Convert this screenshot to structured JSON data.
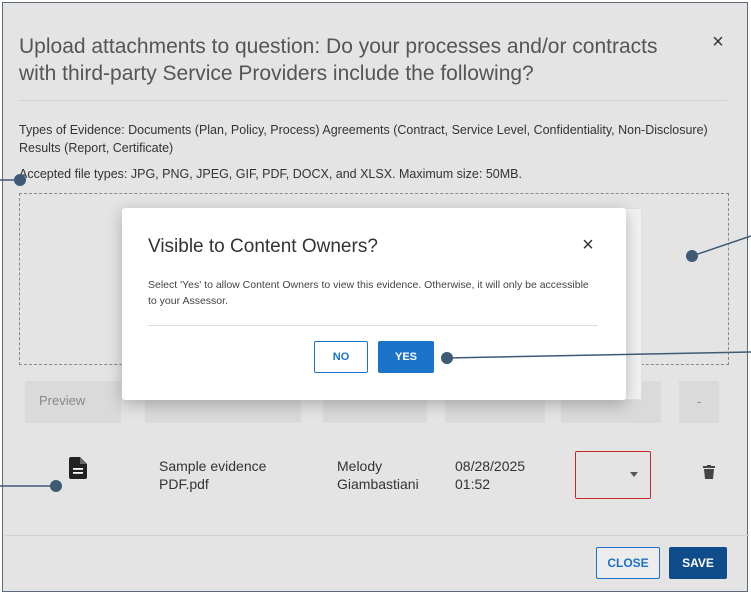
{
  "dialog": {
    "title": "Upload attachments to question: Do your processes and/or contracts with third-party Service Providers include the following?",
    "close_icon": "×",
    "types_of_evidence": "Types of Evidence: Documents (Plan, Policy, Process) Agreements (Contract, Service Level, Confidentiality, Non-Disclosure) Results (Report, Certificate)",
    "accepted_types": "Accepted file types: JPG, PNG, JPEG, GIF, PDF, DOCX, and XLSX. Maximum size: 50MB.",
    "table": {
      "preview_header": "Preview",
      "last_header": "-"
    },
    "row": {
      "icon": "document-icon",
      "file_name_line1": "Sample evidence",
      "file_name_line2": "PDF.pdf",
      "owner_line1": "Melody",
      "owner_line2": "Giambastiani",
      "date_line1": "08/28/2025",
      "date_line2": "01:52",
      "visibility_select_value": ""
    },
    "close_button": "CLOSE",
    "save_button": "SAVE"
  },
  "modal": {
    "title": "Visible to Content Owners?",
    "close_icon": "×",
    "body": "Select 'Yes' to allow Content Owners to view this evidence. Otherwise, it will only be accessible to your Assessor.",
    "no_button": "NO",
    "yes_button": "YES"
  },
  "colors": {
    "primary": "#1a73c9",
    "save": "#0f4d8a",
    "error_border": "#c62828",
    "callout": "#3f5a75"
  }
}
